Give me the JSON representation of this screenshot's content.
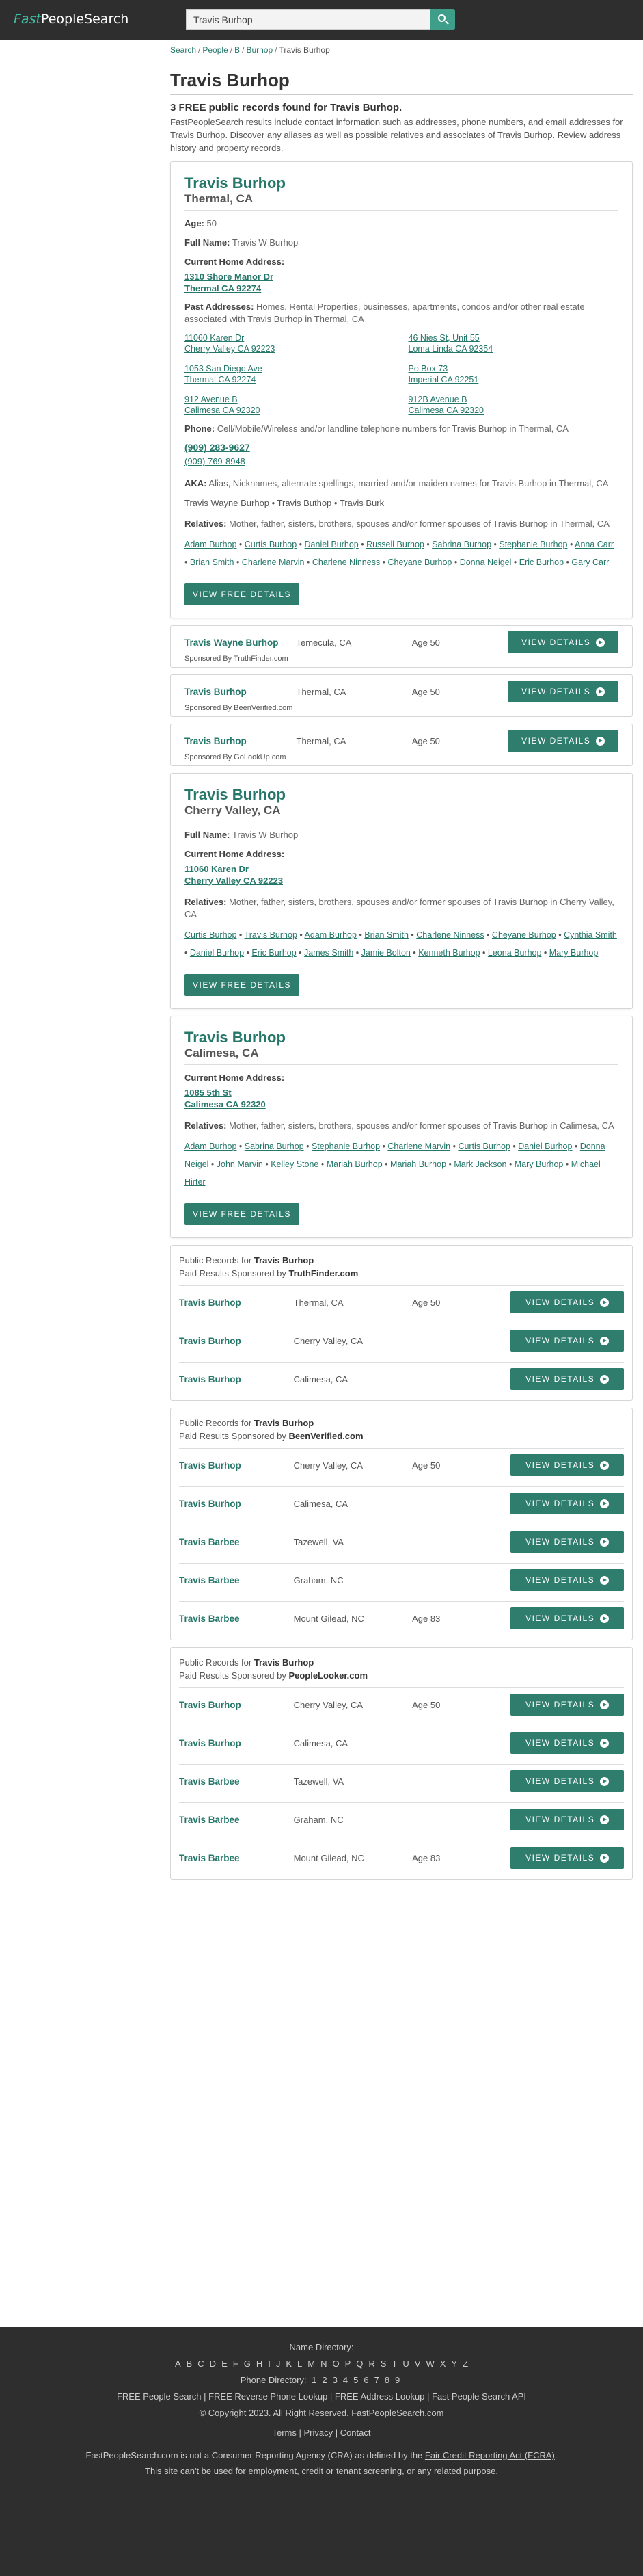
{
  "header": {
    "logo_fast": "Fast",
    "logo_rest": "PeopleSearch",
    "search_value": "Travis Burhop"
  },
  "breadcrumb": [
    "Search",
    "People",
    "B",
    "Burhop",
    "Travis Burhop"
  ],
  "page_title": "Travis Burhop",
  "intro": {
    "heading": "3 FREE public records found for Travis Burhop.",
    "text": "FastPeopleSearch results include contact information such as addresses, phone numbers, and email addresses for Travis Burhop. Discover any aliases as well as possible relatives and associates of Travis Burhop. Review address history and property records."
  },
  "card1": {
    "name": "Travis Burhop",
    "location": "Thermal, CA",
    "age_label": "Age:",
    "age": "50",
    "fullname_label": "Full Name:",
    "fullname": "Travis W Burhop",
    "current_label": "Current Home Address:",
    "current_line1": "1310 Shore Manor Dr",
    "current_line2": "Thermal CA 92274",
    "past_label": "Past Addresses:",
    "past_desc": "Homes, Rental Properties, businesses, apartments, condos and/or other real estate associated with Travis Burhop in Thermal, CA",
    "past": [
      {
        "l1": "11060 Karen Dr",
        "l2": "Cherry Valley CA 92223"
      },
      {
        "l1": "46 Nies St, Unit 55",
        "l2": "Loma Linda CA 92354"
      },
      {
        "l1": "1053 San Diego Ave",
        "l2": "Thermal CA 92274"
      },
      {
        "l1": "Po Box 73",
        "l2": "Imperial CA 92251"
      },
      {
        "l1": "912 Avenue B",
        "l2": "Calimesa CA 92320"
      },
      {
        "l1": "912B Avenue B",
        "l2": "Calimesa CA 92320"
      }
    ],
    "phone_label": "Phone:",
    "phone_desc": "Cell/Mobile/Wireless and/or landline telephone numbers for Travis Burhop in Thermal, CA",
    "phone1": "(909) 283-9627",
    "phone2": "(909) 769-8948",
    "aka_label": "AKA:",
    "aka_desc": "Alias, Nicknames, alternate spellings, married and/or maiden names for Travis Burhop in Thermal, CA",
    "aka_names": "Travis Wayne Burhop • Travis Buthop • Travis Burk",
    "rel_label": "Relatives:",
    "rel_desc": "Mother, father, sisters, brothers, spouses and/or former spouses of Travis Burhop in Thermal, CA",
    "relatives": [
      "Adam Burhop",
      "Curtis Burhop",
      "Daniel Burhop",
      "Russell Burhop",
      "Sabrina Burhop",
      "Stephanie Burhop",
      "Anna Carr",
      "Brian Smith",
      "Charlene Marvin",
      "Charlene Ninness",
      "Cheyane Burhop",
      "Donna Neigel",
      "Eric Burhop",
      "Gary Carr"
    ],
    "btn": "VIEW FREE DETAILS"
  },
  "sponsored_rows": [
    {
      "name": "Travis Wayne Burhop",
      "city": "Temecula, CA",
      "age": "Age 50",
      "btn": "VIEW DETAILS",
      "by": "Sponsored By TruthFinder.com"
    },
    {
      "name": "Travis Burhop",
      "city": "Thermal, CA",
      "age": "Age 50",
      "btn": "VIEW DETAILS",
      "by": "Sponsored By BeenVerified.com"
    },
    {
      "name": "Travis Burhop",
      "city": "Thermal, CA",
      "age": "Age 50",
      "btn": "VIEW DETAILS",
      "by": "Sponsored By GoLookUp.com"
    }
  ],
  "card2": {
    "name": "Travis Burhop",
    "location": "Cherry Valley, CA",
    "fullname_label": "Full Name:",
    "fullname": "Travis W Burhop",
    "current_label": "Current Home Address:",
    "current_line1": "11060 Karen Dr",
    "current_line2": "Cherry Valley CA 92223",
    "rel_label": "Relatives:",
    "rel_desc": "Mother, father, sisters, brothers, spouses and/or former spouses of Travis Burhop in Cherry Valley, CA",
    "relatives": [
      "Curtis Burhop",
      "Travis Burhop",
      "Adam Burhop",
      "Brian Smith",
      "Charlene Ninness",
      "Cheyane Burhop",
      "Cynthia Smith",
      "Daniel Burhop",
      "Eric Burhop",
      "James Smith",
      "Jamie Bolton",
      "Kenneth Burhop",
      "Leona Burhop",
      "Mary Burhop"
    ],
    "btn": "VIEW FREE DETAILS"
  },
  "card3": {
    "name": "Travis Burhop",
    "location": "Calimesa, CA",
    "current_label": "Current Home Address:",
    "current_line1": "1085 5th St",
    "current_line2": "Calimesa CA 92320",
    "rel_label": "Relatives:",
    "rel_desc": "Mother, father, sisters, brothers, spouses and/or former spouses of Travis Burhop in Calimesa, CA",
    "relatives": [
      "Adam Burhop",
      "Sabrina Burhop",
      "Stephanie Burhop",
      "Charlene Marvin",
      "Curtis Burhop",
      "Daniel Burhop",
      "Donna Neigel",
      "John Marvin",
      "Kelley Stone",
      "Mariah Burhop",
      "Mariah Burhop",
      "Mark Jackson",
      "Mary Burhop",
      "Michael Hirter"
    ],
    "btn": "VIEW FREE DETAILS"
  },
  "public_records": [
    {
      "prefix": "Public Records for ",
      "name": "Travis Burhop",
      "paid": "Paid Results Sponsored by ",
      "sponsor": "TruthFinder.com",
      "rows": [
        {
          "name": "Travis Burhop",
          "city": "Thermal, CA",
          "age": "Age 50"
        },
        {
          "name": "Travis Burhop",
          "city": "Cherry Valley, CA",
          "age": ""
        },
        {
          "name": "Travis Burhop",
          "city": "Calimesa, CA",
          "age": ""
        }
      ]
    },
    {
      "prefix": "Public Records for ",
      "name": "Travis Burhop",
      "paid": "Paid Results Sponsored by ",
      "sponsor": "BeenVerified.com",
      "rows": [
        {
          "name": "Travis Burhop",
          "city": "Cherry Valley, CA",
          "age": "Age 50"
        },
        {
          "name": "Travis Burhop",
          "city": "Calimesa, CA",
          "age": ""
        },
        {
          "name": "Travis Barbee",
          "city": "Tazewell, VA",
          "age": ""
        },
        {
          "name": "Travis Barbee",
          "city": "Graham, NC",
          "age": ""
        },
        {
          "name": "Travis Barbee",
          "city": "Mount Gilead, NC",
          "age": "Age 83"
        }
      ]
    },
    {
      "prefix": "Public Records for ",
      "name": "Travis Burhop",
      "paid": "Paid Results Sponsored by ",
      "sponsor": "PeopleLooker.com",
      "rows": [
        {
          "name": "Travis Burhop",
          "city": "Cherry Valley, CA",
          "age": "Age 50"
        },
        {
          "name": "Travis Burhop",
          "city": "Calimesa, CA",
          "age": ""
        },
        {
          "name": "Travis Barbee",
          "city": "Tazewell, VA",
          "age": ""
        },
        {
          "name": "Travis Barbee",
          "city": "Graham, NC",
          "age": ""
        },
        {
          "name": "Travis Barbee",
          "city": "Mount Gilead, NC",
          "age": "Age 83"
        }
      ]
    }
  ],
  "view_details": "VIEW DETAILS",
  "footer": {
    "name_dir": "Name Directory:",
    "letters": [
      "A",
      "B",
      "C",
      "D",
      "E",
      "F",
      "G",
      "H",
      "I",
      "J",
      "K",
      "L",
      "M",
      "N",
      "O",
      "P",
      "Q",
      "R",
      "S",
      "T",
      "U",
      "V",
      "W",
      "X",
      "Y",
      "Z"
    ],
    "phone_dir": "Phone Directory:",
    "digits": [
      "1",
      "2",
      "3",
      "4",
      "5",
      "6",
      "7",
      "8",
      "9"
    ],
    "links": "FREE People Search | FREE Reverse Phone Lookup | FREE Address Lookup | Fast People Search API",
    "copyright": "© Copyright 2023. All Right Reserved. FastPeopleSearch.com",
    "terms": "Terms | Privacy | Contact",
    "disclaimer1": "FastPeopleSearch.com is not a Consumer Reporting Agency (CRA) as defined by the ",
    "fcra": "Fair Credit Reporting Act (FCRA)",
    "disclaimer2": ". This site can't be used for employment, credit or tenant screening, or any related purpose."
  }
}
